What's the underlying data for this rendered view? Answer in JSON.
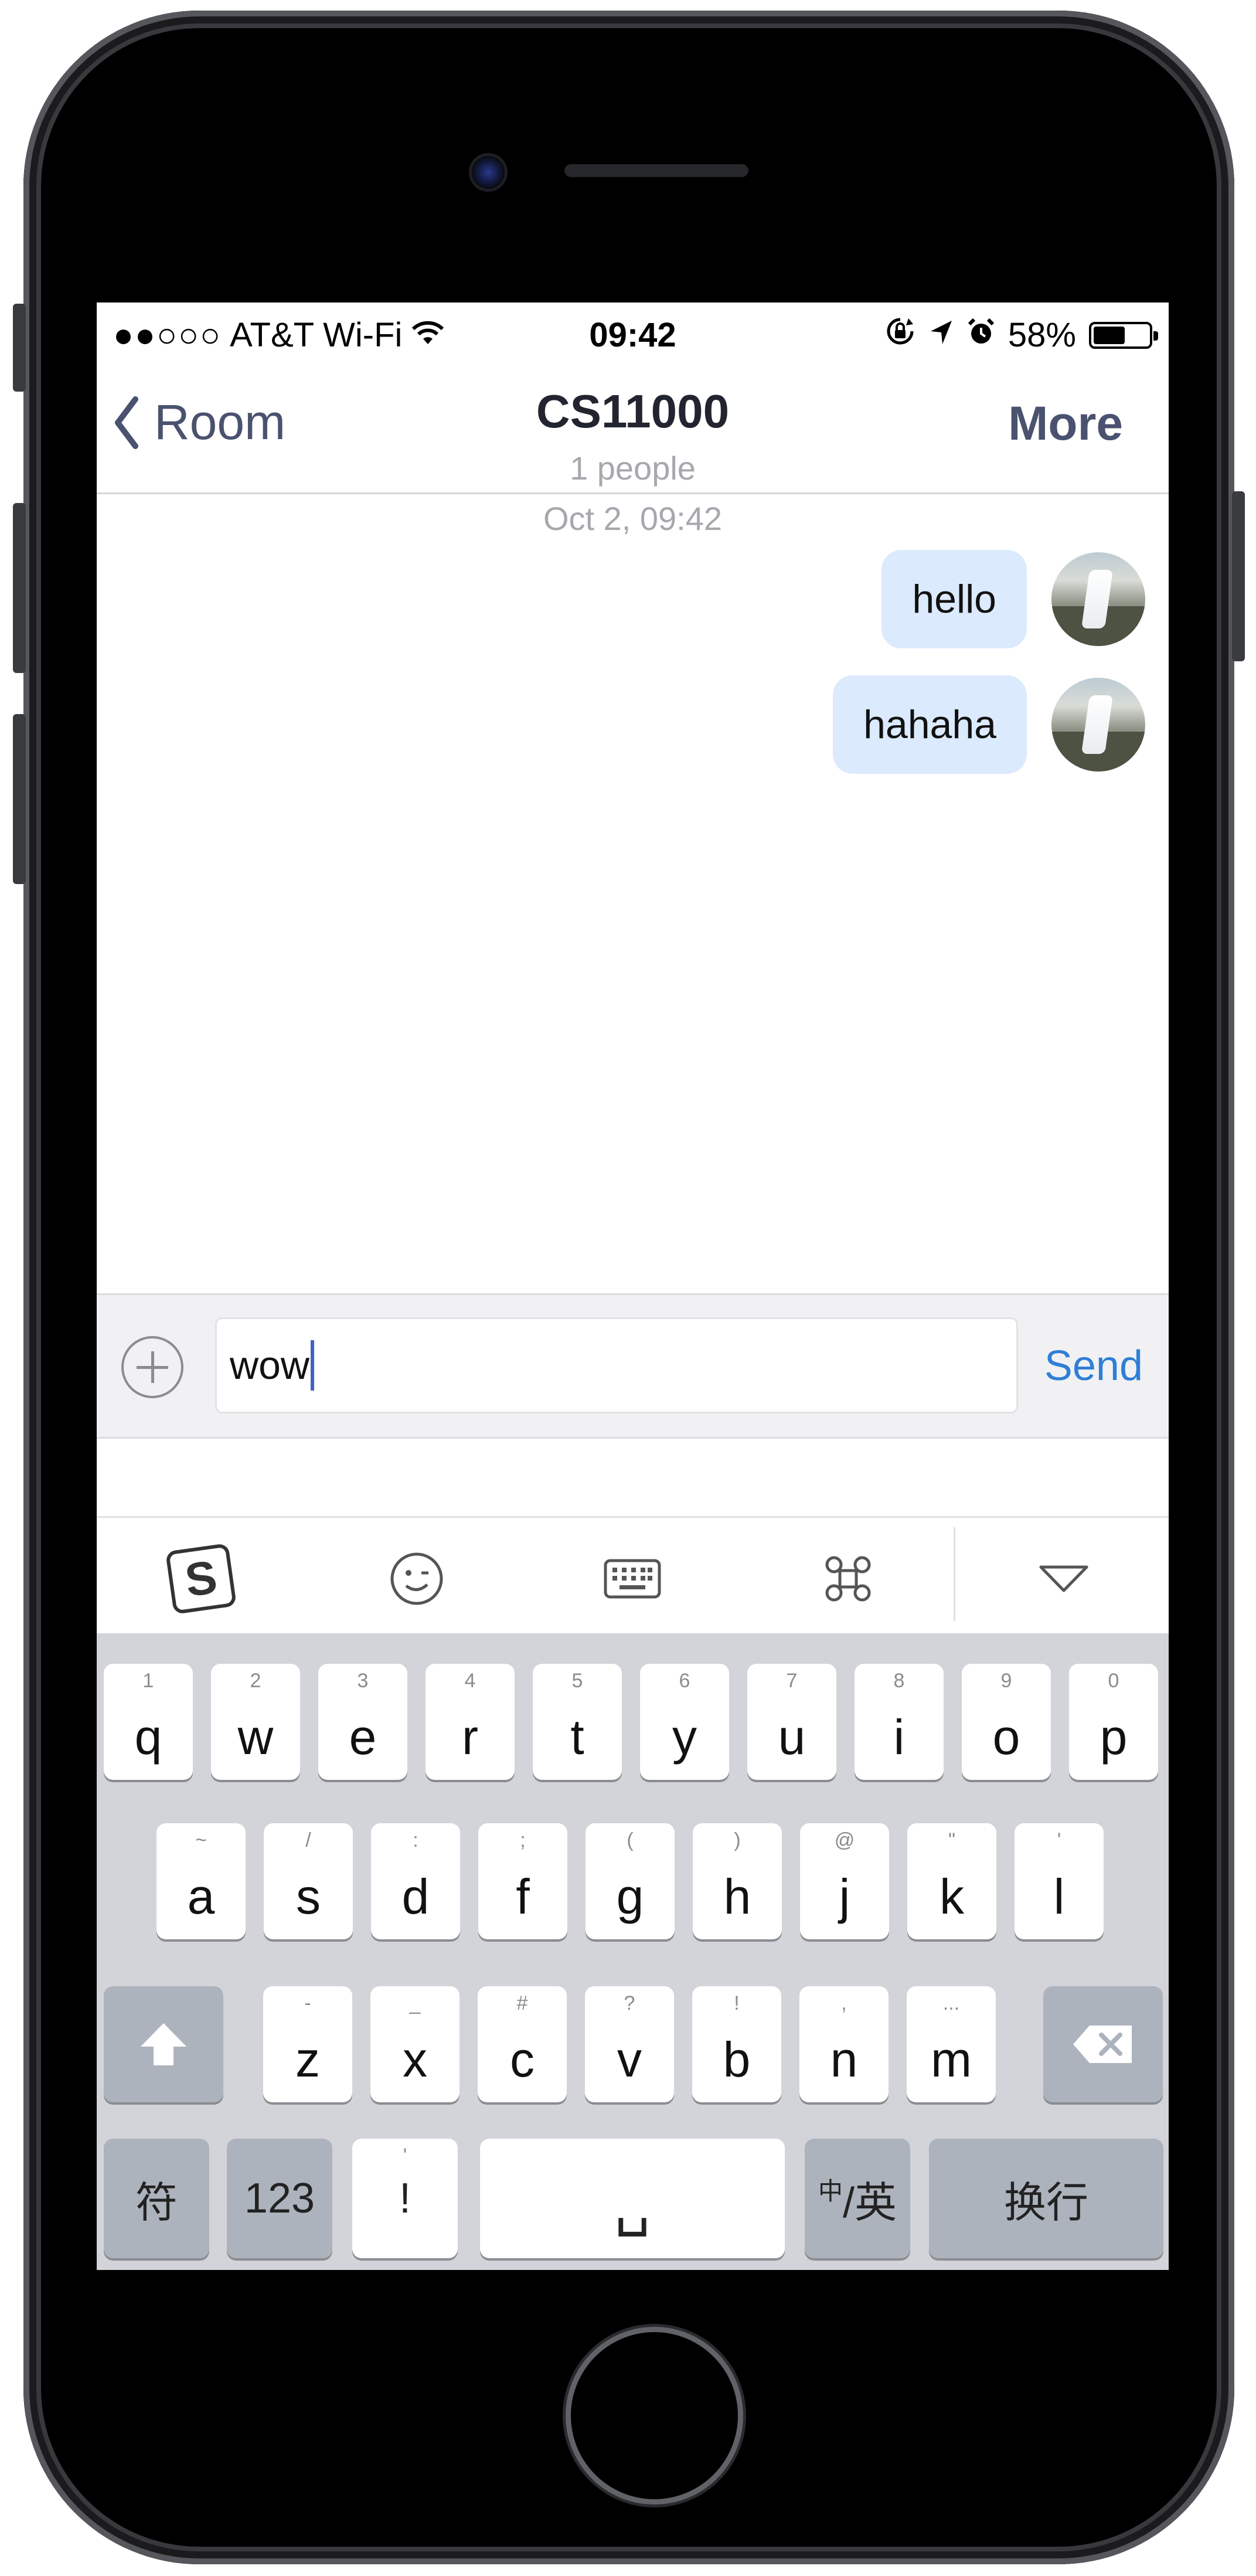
{
  "status_bar": {
    "signal_dots": "●●○○○",
    "carrier": "AT&T Wi-Fi",
    "time": "09:42",
    "battery": "58%",
    "battery_level": 0.58,
    "icons": [
      "wifi-icon",
      "rotation-lock-icon",
      "location-arrow-icon",
      "alarm-icon",
      "battery-icon"
    ]
  },
  "nav": {
    "back_label": "Room",
    "title": "CS11000",
    "subtitle": "1 people",
    "right_label": "More"
  },
  "chat": {
    "timestamp": "Oct 2, 09:42",
    "messages": [
      {
        "text": "hello",
        "sender": "me"
      },
      {
        "text": "hahaha",
        "sender": "me"
      }
    ]
  },
  "composer": {
    "value": "wow",
    "send_label": "Send"
  },
  "keyboard_toolbar": {
    "items": [
      "sogou-logo-icon",
      "emoji-icon",
      "keyboard-icon",
      "command-icon",
      "collapse-triangle-icon"
    ]
  },
  "keyboard": {
    "row1": [
      {
        "ch": "q",
        "hint": "1"
      },
      {
        "ch": "w",
        "hint": "2"
      },
      {
        "ch": "e",
        "hint": "3"
      },
      {
        "ch": "r",
        "hint": "4"
      },
      {
        "ch": "t",
        "hint": "5"
      },
      {
        "ch": "y",
        "hint": "6"
      },
      {
        "ch": "u",
        "hint": "7"
      },
      {
        "ch": "i",
        "hint": "8"
      },
      {
        "ch": "o",
        "hint": "9"
      },
      {
        "ch": "p",
        "hint": "0"
      }
    ],
    "row2": [
      {
        "ch": "a",
        "hint": "~"
      },
      {
        "ch": "s",
        "hint": "/"
      },
      {
        "ch": "d",
        "hint": ":"
      },
      {
        "ch": "f",
        "hint": ";"
      },
      {
        "ch": "g",
        "hint": "("
      },
      {
        "ch": "h",
        "hint": ")"
      },
      {
        "ch": "j",
        "hint": "@"
      },
      {
        "ch": "k",
        "hint": "\""
      },
      {
        "ch": "l",
        "hint": "'"
      }
    ],
    "row3": [
      {
        "ch": "z",
        "hint": "-"
      },
      {
        "ch": "x",
        "hint": "_"
      },
      {
        "ch": "c",
        "hint": "#"
      },
      {
        "ch": "v",
        "hint": "?"
      },
      {
        "ch": "b",
        "hint": "!"
      },
      {
        "ch": "n",
        "hint": ","
      },
      {
        "ch": "m",
        "hint": "..."
      }
    ],
    "symbols_label": "符",
    "numbers_label": "123",
    "punct_label": "!",
    "punct_hint": "'",
    "space_label": "␣",
    "lang_small": "中",
    "lang_label": "/英",
    "return_label": "换行"
  }
}
